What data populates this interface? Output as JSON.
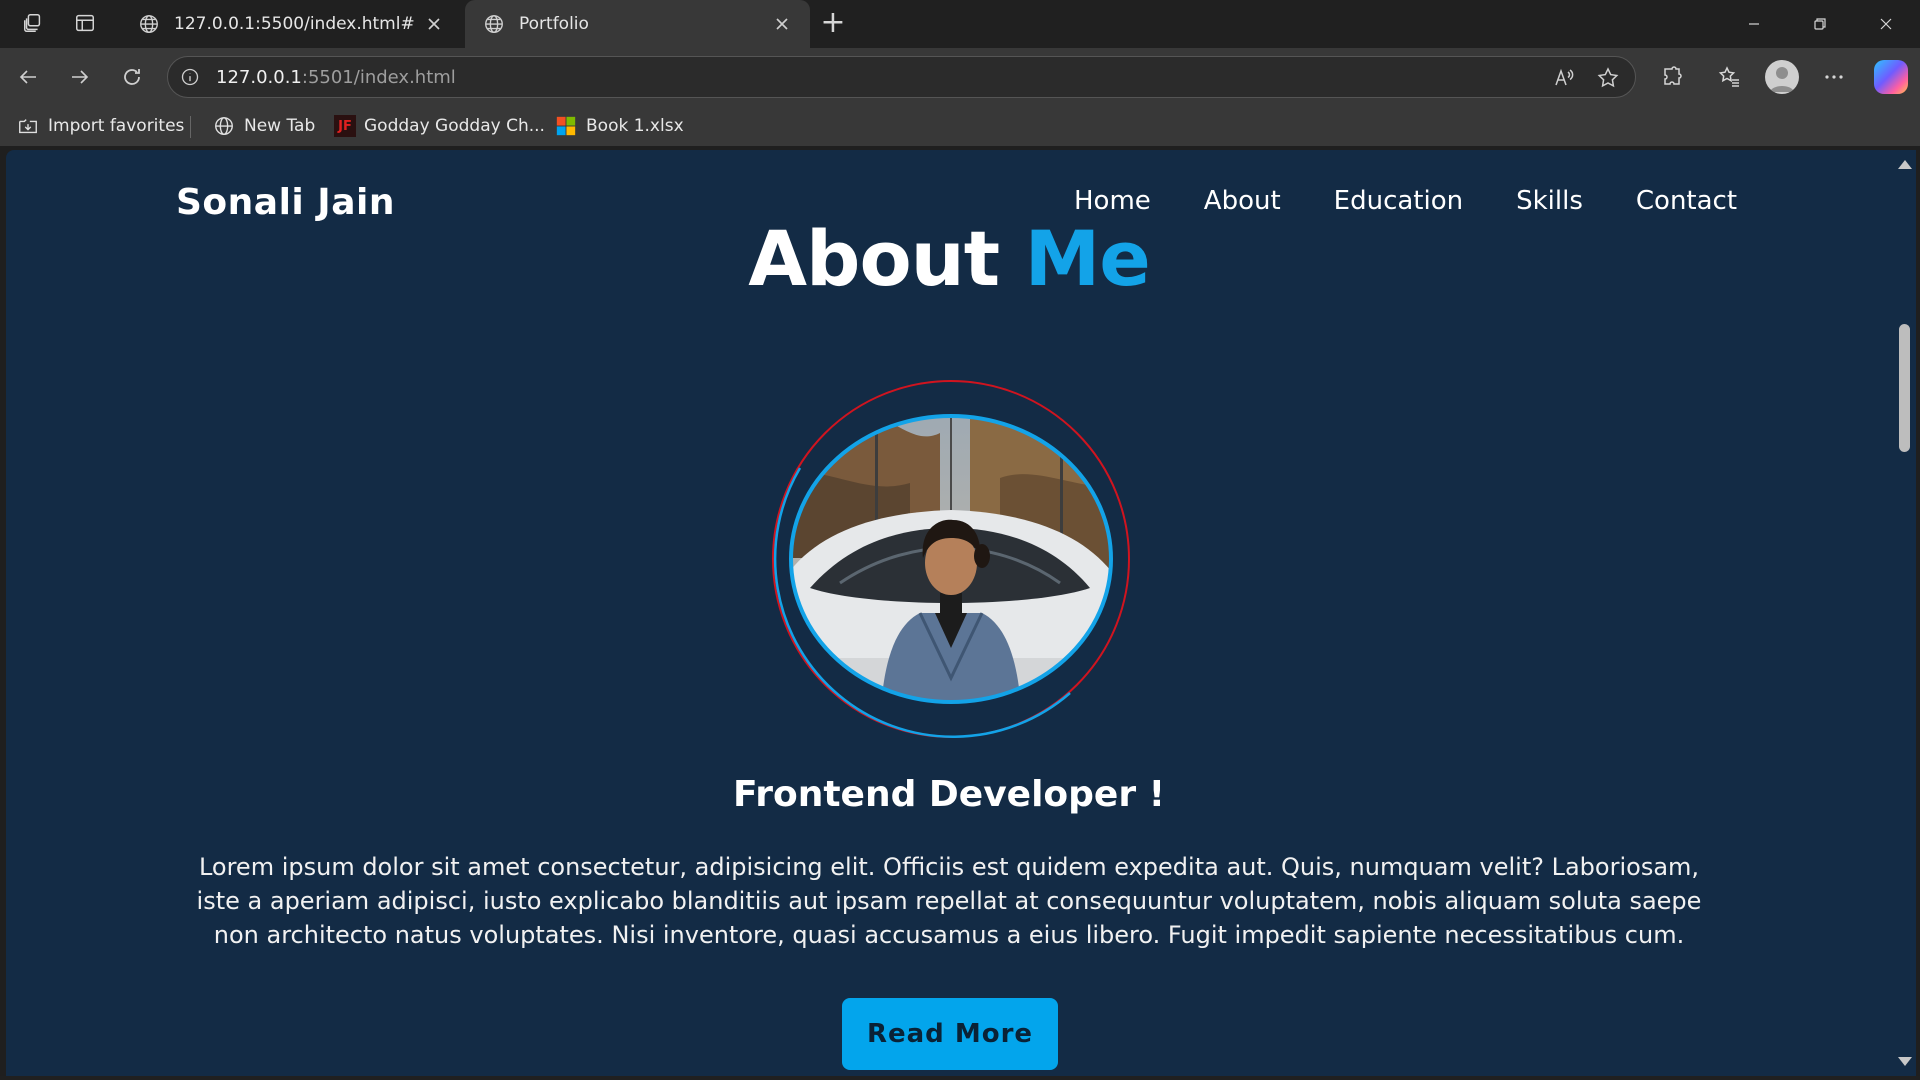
{
  "browser": {
    "tabs": [
      {
        "title": "127.0.0.1:5500/index.html#"
      },
      {
        "title": "Portfolio"
      }
    ],
    "address": {
      "host": "127.0.0.1",
      "rest": ":5501/index.html"
    },
    "favorites": [
      {
        "label": "Import favorites",
        "icon": "import-icon"
      },
      {
        "label": "New Tab",
        "icon": "globe-icon"
      },
      {
        "label": "Godday Godday Ch...",
        "icon": "jf-icon",
        "icon_text": "JF"
      },
      {
        "label": "Book 1.xlsx",
        "icon": "windows-icon"
      }
    ]
  },
  "site": {
    "logo": "Sonali Jain",
    "nav": [
      "Home",
      "About",
      "Education",
      "Skills",
      "Contact"
    ],
    "heading_main": "About",
    "heading_accent": "Me",
    "role": "Frontend Developer !",
    "bio": "Lorem ipsum dolor sit amet consectetur, adipisicing elit. Officiis est quidem expedita aut. Quis, numquam velit? Laboriosam, iste a aperiam adipisci, iusto explicabo blanditiis aut ipsam repellat at consequuntur voluptatem, nobis aliquam soluta saepe non architecto natus voluptates. Nisi inventore, quasi accusamus a eius libero. Fugit impedit sapiente necessitatibus cum.",
    "button": "Read More"
  },
  "colors": {
    "page_bg": "#132b45",
    "accent": "#13a3e8",
    "ring_red": "#d0141f",
    "button_bg": "#03a5ec"
  }
}
